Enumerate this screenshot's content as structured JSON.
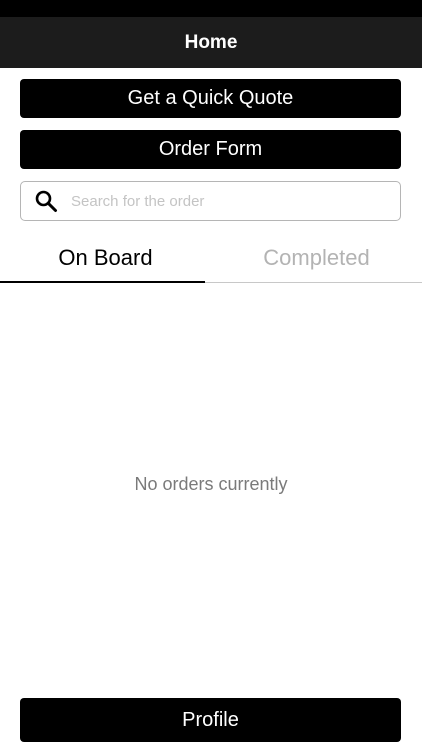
{
  "header": {
    "title": "Home"
  },
  "actions": {
    "quick_quote_label": "Get a Quick Quote",
    "order_form_label": "Order Form"
  },
  "search": {
    "placeholder": "Search for the order",
    "value": "",
    "icon": "search-icon"
  },
  "tabs": [
    {
      "label": "On Board",
      "active": true
    },
    {
      "label": "Completed",
      "active": false
    }
  ],
  "content": {
    "empty_message": "No orders currently"
  },
  "footer": {
    "profile_label": "Profile"
  },
  "colors": {
    "button_bg": "#000000",
    "nav_bg": "#1c1c1c",
    "inactive_tab": "#b3b3b3"
  }
}
